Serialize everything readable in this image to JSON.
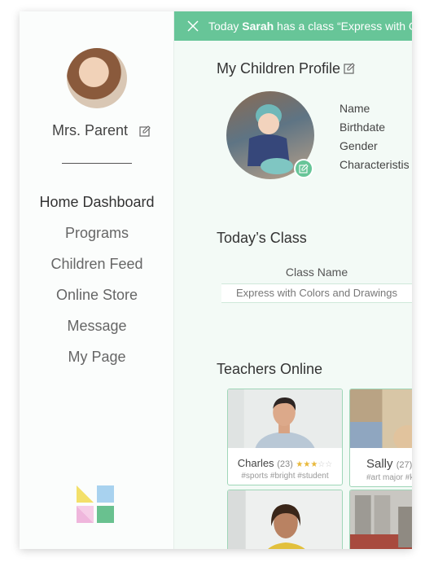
{
  "parent": {
    "name": "Mrs. Parent"
  },
  "nav": {
    "items": [
      {
        "label": "Home Dashboard",
        "active": true
      },
      {
        "label": "Programs"
      },
      {
        "label": "Children Feed"
      },
      {
        "label": "Online Store"
      },
      {
        "label": "Message"
      },
      {
        "label": "My Page"
      }
    ]
  },
  "banner": {
    "text_prefix": "Today ",
    "name": "Sarah",
    "text_mid": " has  a class ",
    "class_text": "“Express with C"
  },
  "profile": {
    "title": "My Children Profile",
    "fields": [
      "Name",
      "Birthdate",
      "Gender",
      "Characteristis"
    ]
  },
  "today_class": {
    "title": "Today’s Class",
    "column_header": "Class Name",
    "row": "Express with Colors and Drawings"
  },
  "teachers": {
    "title": "Teachers Online",
    "cards": [
      {
        "name": "Charles",
        "age": "(23)",
        "rating": 3,
        "tags": "#sports #bright #student"
      },
      {
        "name": "Sally",
        "age": "(27)",
        "tags": "#art major #k"
      }
    ]
  },
  "colors": {
    "accent": "#67c598",
    "card_border": "#9fd6b8",
    "main_bg": "#f3faf6"
  }
}
